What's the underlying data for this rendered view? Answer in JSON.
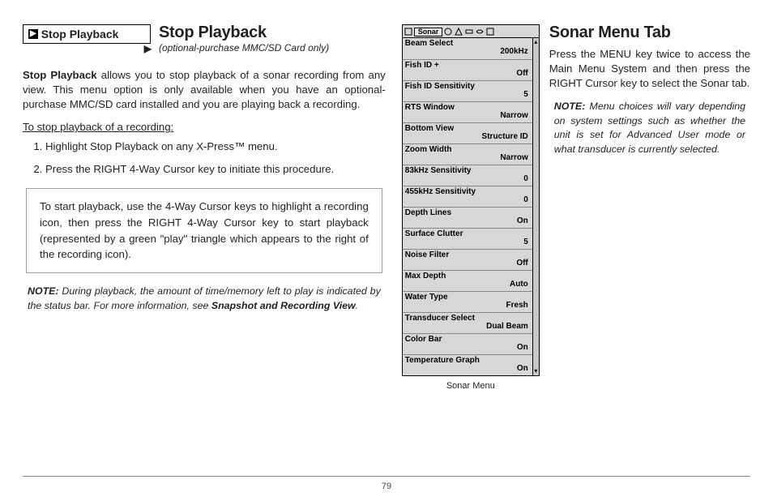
{
  "pageNumber": "79",
  "left": {
    "buttonLabel": "Stop Playback",
    "heading": "Stop Playback",
    "subhead": "(optional-purchase MMC/SD Card only)",
    "intro_bold": "Stop Playback",
    "intro_rest": " allows you to stop playback of a sonar recording from any view. This menu option is only available when you have an optional-purchase MMC/SD card installed and you are playing back a recording.",
    "steps_title": "To stop playback of a recording:",
    "steps": [
      "Highlight Stop Playback on any X-Press™ menu.",
      "Press the RIGHT 4-Way Cursor key to initiate this procedure."
    ],
    "inset": "To start playback, use the 4-Way Cursor keys to highlight a recording icon, then press the RIGHT 4-Way Cursor key to start playback (represented by a green \"play\" triangle which appears to the right of the recording icon).",
    "note_prefix": "NOTE:",
    "note_body": "  During playback, the amount of time/memory left to play is indicated by the status bar. For more information, see ",
    "note_emph": "Snapshot and Recording View",
    "note_tail": "."
  },
  "right": {
    "heading": "Sonar Menu Tab",
    "body": "Press the MENU key twice to access the Main Menu System and then press the RIGHT Cursor key to select the Sonar tab.",
    "note_prefix": "NOTE:",
    "note_body": " Menu choices will vary depending on system settings such as whether the unit is set for Advanced User mode or what transducer is currently selected."
  },
  "sonar": {
    "activeTab": "Sonar",
    "caption": "Sonar Menu",
    "rows": [
      {
        "label": "Beam Select",
        "value": "200kHz"
      },
      {
        "label": "Fish ID +",
        "value": "Off"
      },
      {
        "label": "Fish ID Sensitivity",
        "value": "5"
      },
      {
        "label": "RTS Window",
        "value": "Narrow"
      },
      {
        "label": "Bottom View",
        "value": "Structure ID"
      },
      {
        "label": "Zoom Width",
        "value": "Narrow"
      },
      {
        "label": "83kHz Sensitivity",
        "value": "0"
      },
      {
        "label": "455kHz Sensitivity",
        "value": "0"
      },
      {
        "label": "Depth Lines",
        "value": "On"
      },
      {
        "label": "Surface Clutter",
        "value": "5"
      },
      {
        "label": "Noise Filter",
        "value": "Off"
      },
      {
        "label": "Max Depth",
        "value": "Auto"
      },
      {
        "label": "Water Type",
        "value": "Fresh"
      },
      {
        "label": "Transducer Select",
        "value": "Dual Beam"
      },
      {
        "label": "Color Bar",
        "value": "On"
      },
      {
        "label": "Temperature Graph",
        "value": "On"
      }
    ]
  }
}
